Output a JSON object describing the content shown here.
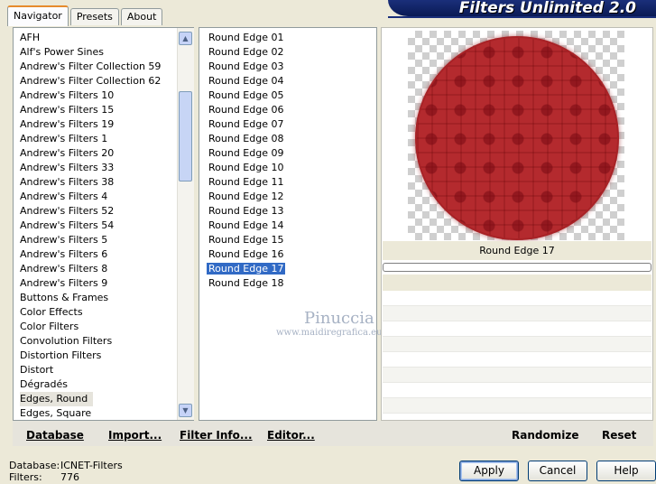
{
  "tabs": [
    {
      "label": "Navigator",
      "active": true
    },
    {
      "label": "Presets",
      "active": false
    },
    {
      "label": "About",
      "active": false
    }
  ],
  "banner": {
    "title": "Filters Unlimited 2.0"
  },
  "categories": [
    "AFH",
    "Alf's Power Sines",
    "Andrew's Filter Collection 59",
    "Andrew's Filter Collection 62",
    "Andrew's Filters 10",
    "Andrew's Filters 15",
    "Andrew's Filters 19",
    "Andrew's Filters 1",
    "Andrew's Filters 20",
    "Andrew's Filters 33",
    "Andrew's Filters 38",
    "Andrew's Filters 4",
    "Andrew's Filters 52",
    "Andrew's Filters 54",
    "Andrew's Filters 5",
    "Andrew's Filters 6",
    "Andrew's Filters 8",
    "Andrew's Filters 9",
    "Buttons & Frames",
    "Color Effects",
    "Color Filters",
    "Convolution Filters",
    "Distortion Filters",
    "Distort",
    "Dégradés",
    "Edges, Round",
    "Edges, Square"
  ],
  "selected_category": "Edges, Round",
  "effects": [
    "Round Edge 01",
    "Round Edge 02",
    "Round Edge 03",
    "Round Edge 04",
    "Round Edge 05",
    "Round Edge 06",
    "Round Edge 07",
    "Round Edge 08",
    "Round Edge 09",
    "Round Edge 10",
    "Round Edge 11",
    "Round Edge 12",
    "Round Edge 13",
    "Round Edge 14",
    "Round Edge 15",
    "Round Edge 16",
    "Round Edge 17",
    "Round Edge 18"
  ],
  "selected_effect": "Round Edge 17",
  "preview": {
    "label": "Round Edge 17"
  },
  "watermark": {
    "name": "Pinuccia",
    "url": "www.maidiregrafica.eu"
  },
  "toolbar": {
    "database": "Database",
    "import": "Import...",
    "filter_info": "Filter Info...",
    "editor": "Editor...",
    "randomize": "Randomize",
    "reset": "Reset"
  },
  "footer": {
    "database_label": "Database:",
    "database_value": "ICNET-Filters",
    "filters_label": "Filters:",
    "filters_value": "776"
  },
  "buttons": {
    "apply": "Apply",
    "cancel": "Cancel",
    "help": "Help"
  },
  "colors": {
    "accent": "#316ac5",
    "preview_red": "#b42a2e",
    "banner": "#1a2f7a"
  }
}
